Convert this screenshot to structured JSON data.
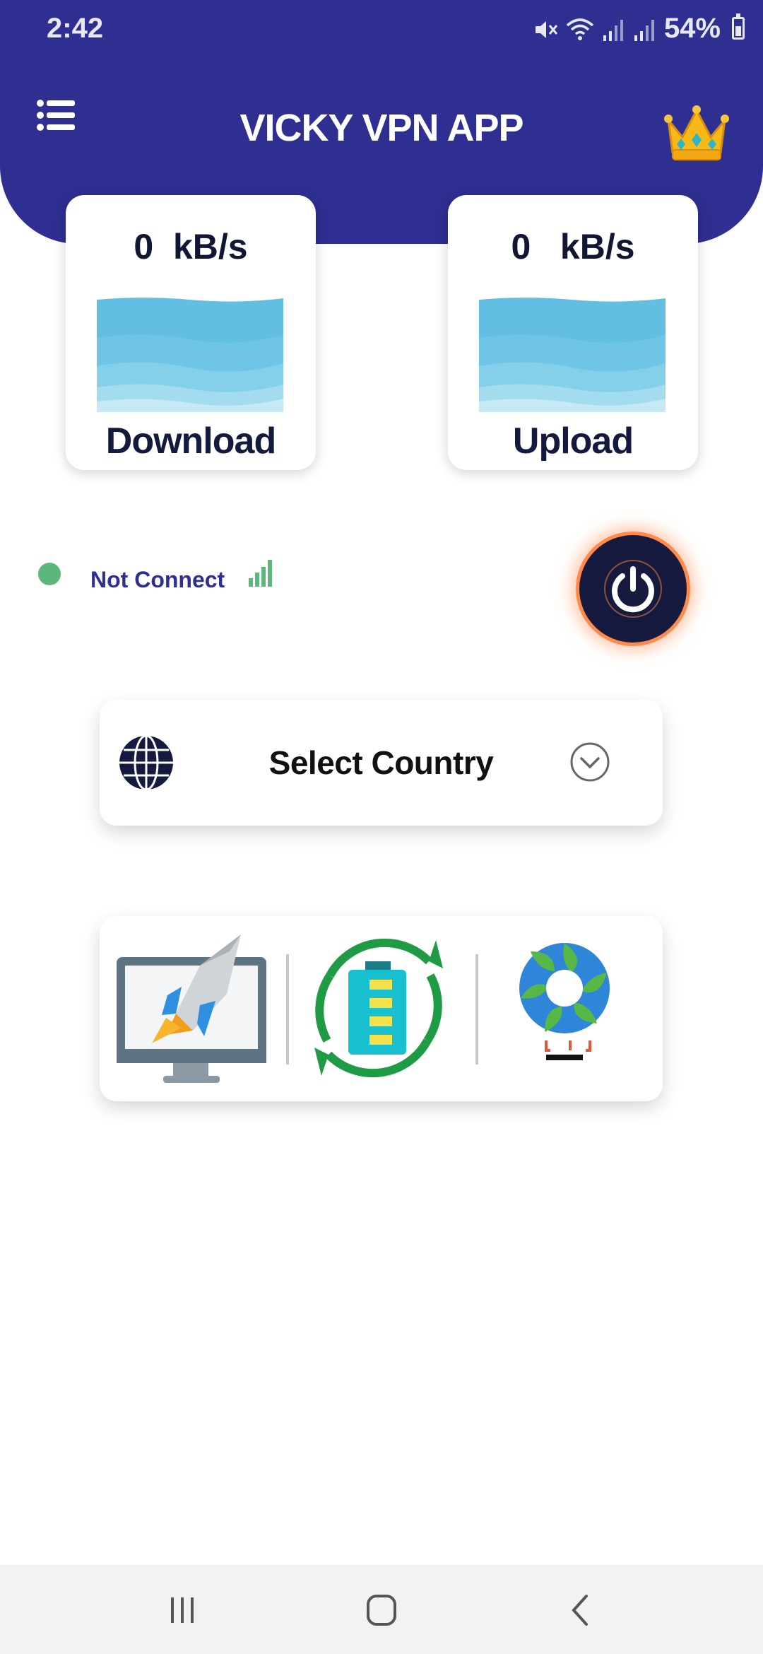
{
  "status_bar": {
    "time": "2:42",
    "battery": "54%",
    "icons": [
      "mute-icon",
      "wifi-icon",
      "signal-icon",
      "signal-icon",
      "battery-charging-icon"
    ]
  },
  "header": {
    "title": "VICKY VPN APP",
    "menu_icon": "menu-list-icon",
    "premium_icon": "crown-icon"
  },
  "speed": {
    "download": {
      "value": "0  kB/s",
      "label": "Download"
    },
    "upload": {
      "value": "0   kB/s",
      "label": "Upload"
    }
  },
  "connection": {
    "status": "Not Connect",
    "status_color": "#5cb87a",
    "power_icon": "power-icon"
  },
  "country_selector": {
    "label": "Select Country",
    "icon": "globe-icon",
    "dropdown_icon": "chevron-down-icon"
  },
  "tools": [
    {
      "name": "booster",
      "icon": "rocket-booster-icon"
    },
    {
      "name": "battery",
      "icon": "battery-saver-icon"
    },
    {
      "name": "cooler",
      "icon": "cpu-cooler-icon"
    }
  ],
  "colors": {
    "primary": "#2e2f91",
    "dark": "#161a3f",
    "accent_glow": "#ff8a4c",
    "wave": "#62bfe2"
  },
  "nav": {
    "recents_icon": "recents-icon",
    "home_icon": "home-icon",
    "back_icon": "back-icon"
  }
}
